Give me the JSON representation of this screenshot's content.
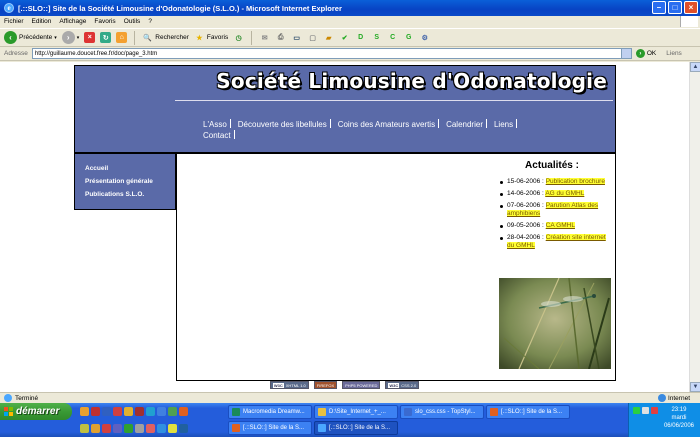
{
  "window": {
    "title": "[.::SLO::] Site de la Société Limousine d'Odonatologie (S.L.O.) - Microsoft Internet Explorer"
  },
  "menu": [
    "Fichier",
    "Edition",
    "Affichage",
    "Favoris",
    "Outils",
    "?"
  ],
  "toolbar": {
    "back_label": "Précédente",
    "search_label": "Rechercher",
    "favorites_label": "Favoris"
  },
  "address": {
    "label": "Adresse",
    "url": "http://guillaume.doucet.free.fr/doc/page_3.htm",
    "go_label": "OK",
    "links_label": "Liens"
  },
  "site": {
    "title": "Société Limousine d'Odonatologie",
    "nav": [
      "L'Asso",
      "Découverte des libellules",
      "Coins des Amateurs avertis",
      "Calendrier",
      "Liens",
      "Contact"
    ],
    "sidebar": [
      "Accueil",
      "Présentation générale",
      "Publications S.L.O."
    ],
    "news_title": "Actualités :",
    "news": [
      {
        "date": "15-06-2006 :",
        "text": "Publication brochure"
      },
      {
        "date": "14-06-2006 :",
        "text": "AG du GMHL"
      },
      {
        "date": "07-06-2006 :",
        "text": "Parution Atlas des amphibiens"
      },
      {
        "date": "09-05-2006 :",
        "text": "CA GMHL"
      },
      {
        "date": "28-04-2006 :",
        "text": "Création site internet du GMHL"
      }
    ],
    "badges": [
      {
        "left": "W3C",
        "right": "XHTML 1.0"
      },
      {
        "left": "",
        "right": "FIREFOX"
      },
      {
        "left": "",
        "right": "PHP5 POWERED"
      },
      {
        "left": "W3C",
        "right": "CSS 2.0"
      }
    ]
  },
  "status": {
    "text": "Terminé",
    "zone": "Internet"
  },
  "taskbar": {
    "start_label": "démarrer",
    "tasks_row1": [
      "Macromedia Dreamw...",
      "D:\\Site_Internet_+_...",
      "slo_css.css - TopStyl...",
      "[.::SLO::] Site de la S..."
    ],
    "tasks_row2": [
      "[.::SLO::] Site de la S...",
      "[.::SLO::] Site de la S..."
    ],
    "time": "23:19",
    "day": "mardi",
    "date": "06/06/2006"
  }
}
